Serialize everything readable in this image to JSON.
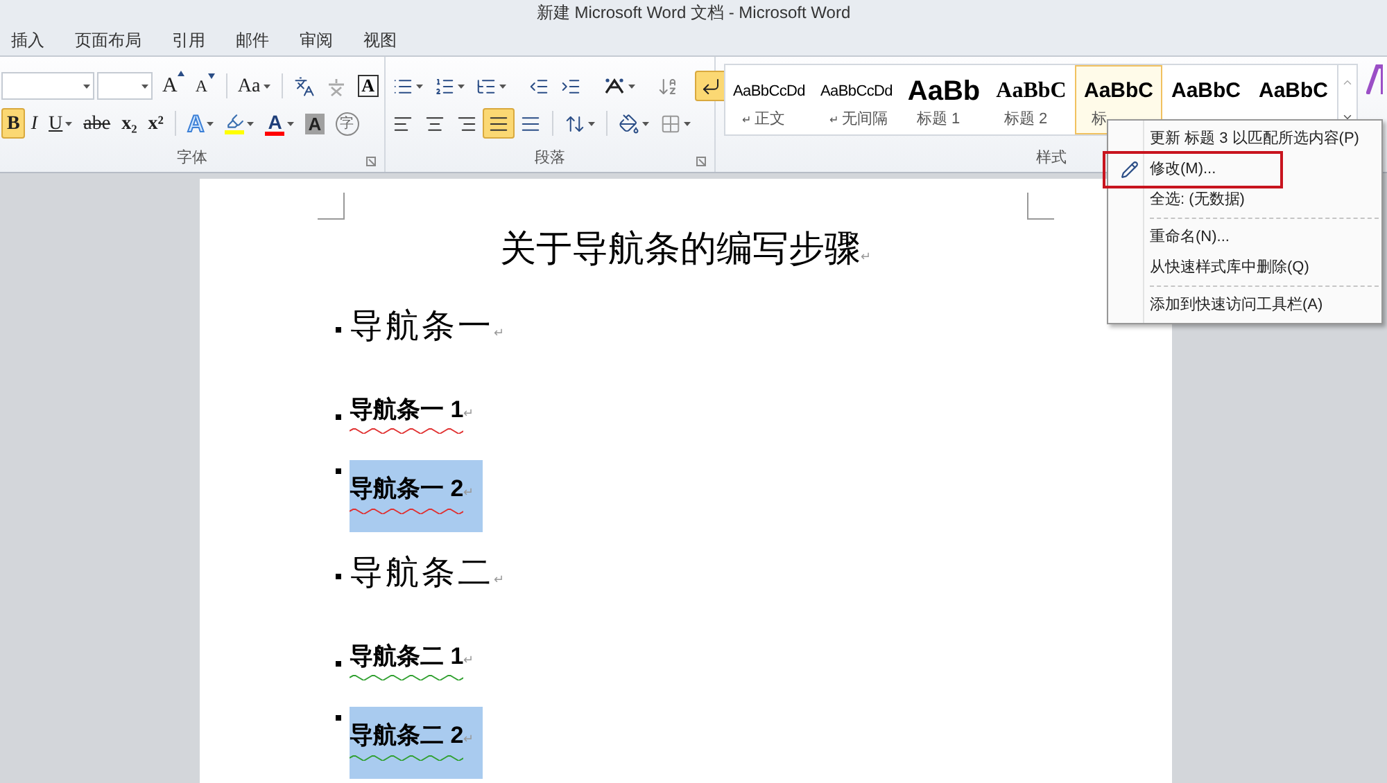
{
  "window": {
    "title": "新建 Microsoft Word 文档 - Microsoft Word"
  },
  "tabs": [
    {
      "label": "插入"
    },
    {
      "label": "页面布局"
    },
    {
      "label": "引用"
    },
    {
      "label": "邮件"
    },
    {
      "label": "审阅"
    },
    {
      "label": "视图"
    }
  ],
  "font_group": {
    "label": "字体",
    "row1": [
      {
        "kind": "combo"
      },
      {
        "kind": "combo-small"
      },
      {
        "kind": "grow",
        "label": "A",
        "pressed": false
      },
      {
        "kind": "shrink",
        "label": "A",
        "pressed": false
      },
      {
        "kind": "sep"
      },
      {
        "kind": "change-case",
        "label": "Aa",
        "pressed": false
      },
      {
        "kind": "sep"
      },
      {
        "kind": "phonetic",
        "pressed": false
      },
      {
        "kind": "wen",
        "pressed": false
      },
      {
        "kind": "boxed-text",
        "label": "A",
        "pressed": false
      }
    ],
    "row2": [
      {
        "kind": "bold",
        "label": "B",
        "pressed": true
      },
      {
        "kind": "italic",
        "label": "I",
        "pressed": false
      },
      {
        "kind": "underline",
        "label": "U",
        "pressed": false
      },
      {
        "kind": "strike",
        "label": "abe",
        "pressed": false
      },
      {
        "kind": "subscript",
        "label": "x₂",
        "pressed": false
      },
      {
        "kind": "superscript",
        "label": "x²",
        "pressed": false
      },
      {
        "kind": "sep"
      },
      {
        "kind": "outlined-text",
        "label": "A",
        "pressed": false
      },
      {
        "kind": "highlighter",
        "color": "#ffff00",
        "pressed": false
      },
      {
        "kind": "color-text",
        "label": "A",
        "color": "#ff0000",
        "pressed": false
      },
      {
        "kind": "shaded-text",
        "label": "A",
        "pressed": false
      },
      {
        "kind": "circled-text",
        "label": "字",
        "pressed": false
      }
    ]
  },
  "paragraph_group": {
    "label": "段落",
    "row1": [
      {
        "kind": "bullets",
        "pressed": false
      },
      {
        "kind": "numbering",
        "pressed": false
      },
      {
        "kind": "multilevel",
        "pressed": false
      },
      {
        "kind": "sep"
      },
      {
        "kind": "outdent",
        "pressed": false
      },
      {
        "kind": "indent",
        "pressed": false
      },
      {
        "kind": "sep"
      },
      {
        "kind": "asian-layout",
        "pressed": false
      },
      {
        "kind": "sep"
      },
      {
        "kind": "sort",
        "pressed": false
      },
      {
        "kind": "sep"
      },
      {
        "kind": "marks",
        "pressed": true
      }
    ],
    "row2": [
      {
        "kind": "align-left",
        "pressed": false
      },
      {
        "kind": "align-center",
        "pressed": false
      },
      {
        "kind": "align-right",
        "pressed": false
      },
      {
        "kind": "justify",
        "pressed": true
      },
      {
        "kind": "distribute",
        "pressed": false
      },
      {
        "kind": "sep"
      },
      {
        "kind": "line-spacing",
        "pressed": false
      },
      {
        "kind": "sep"
      },
      {
        "kind": "shading",
        "pressed": false
      },
      {
        "kind": "borders",
        "pressed": false
      }
    ]
  },
  "styles_group": {
    "label": "样式",
    "items": [
      {
        "preview": "AaBbCcDd",
        "kind": "normal",
        "mark": "↵",
        "name": "正文",
        "selected": false
      },
      {
        "preview": "AaBbCcDd",
        "kind": "normal",
        "mark": "↵",
        "name": "无间隔",
        "selected": false
      },
      {
        "preview": "AaBb",
        "kind": "heading1",
        "name": "标题 1",
        "selected": false
      },
      {
        "preview": "AaBbC",
        "kind": "heading2",
        "name": "标题 2",
        "selected": false
      },
      {
        "preview": "AaBbC",
        "kind": "heading3",
        "name": "标",
        "selected": true
      },
      {
        "preview": "AaBbC",
        "kind": "heading3",
        "selected": false
      },
      {
        "preview": "AaBbC",
        "kind": "heading3",
        "selected": false
      }
    ]
  },
  "context_menu": [
    {
      "kind": "item",
      "label": "更新 标题 3 以匹配所选内容(P)",
      "highlighted": false
    },
    {
      "kind": "item",
      "label": "修改(M)...",
      "icon": true,
      "highlighted": true
    },
    {
      "kind": "item",
      "label": "全选: (无数据)",
      "highlighted": false
    },
    {
      "kind": "separator"
    },
    {
      "kind": "item",
      "label": "重命名(N)...",
      "highlighted": false
    },
    {
      "kind": "item",
      "label": "从快速样式库中删除(Q)",
      "highlighted": false
    },
    {
      "kind": "separator"
    },
    {
      "kind": "item",
      "label": "添加到快速访问工具栏(A)",
      "highlighted": false
    }
  ],
  "document": {
    "title": "关于导航条的编写步骤",
    "title_mark": "↵",
    "paragraphs": [
      {
        "kind": "heading1",
        "text": "导航条一",
        "mark": "↵",
        "spelling_error": false,
        "grammar_error": false,
        "selected": false
      },
      {
        "kind": "heading2",
        "text": "导航条一 1",
        "mark": "↵",
        "spelling_error": true,
        "grammar_error": false,
        "selected": false
      },
      {
        "kind": "heading2",
        "text": "导航条一 2",
        "mark": "↵",
        "spelling_error": true,
        "grammar_error": false,
        "selected": true
      },
      {
        "kind": "heading1",
        "text": "导航条二",
        "mark": "↵",
        "spelling_error": false,
        "grammar_error": false,
        "selected": false
      },
      {
        "kind": "heading2",
        "text": "导航条二 1",
        "mark": "↵",
        "spelling_error": false,
        "grammar_error": true,
        "selected": false
      },
      {
        "kind": "heading2",
        "text": "导航条二 2",
        "mark": "↵",
        "spelling_error": false,
        "grammar_error": true,
        "selected": true
      }
    ]
  }
}
